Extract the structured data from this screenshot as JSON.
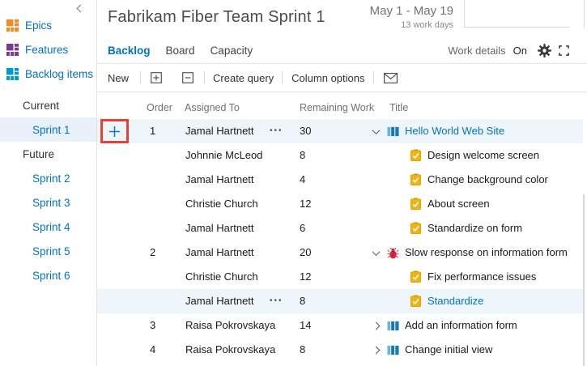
{
  "colors": {
    "accent": "#0072c6",
    "row_highlight": "#eef6fc",
    "annotation_red": "#e84033",
    "epics_icon": "#f58b1f",
    "features_icon": "#773b93",
    "backlog_items_icon": "#009ccc",
    "task_icon_yellow": "#f0b30f",
    "bug_icon_red": "#cc293d",
    "pbi_icon_blue": "#1279c0"
  },
  "icons": {
    "collapse_sidebar": "chevron-left",
    "backlog_level": "treemap-squares",
    "expand_item": "boxed-plus",
    "collapse_item": "boxed-minus",
    "email": "envelope",
    "settings": "gear",
    "fullscreen": "corner-brackets",
    "add_task": "plus",
    "context_menu": "ellipsis-dots"
  },
  "sidebar": {
    "levels": [
      {
        "label": "Epics",
        "color": "#f58b1f"
      },
      {
        "label": "Features",
        "color": "#773b93"
      },
      {
        "label": "Backlog items",
        "color": "#009ccc"
      }
    ],
    "groups": [
      {
        "label": "Current",
        "items": [
          {
            "label": "Sprint 1",
            "selected": true
          }
        ]
      },
      {
        "label": "Future",
        "items": [
          {
            "label": "Sprint 2"
          },
          {
            "label": "Sprint 3"
          },
          {
            "label": "Sprint 4"
          },
          {
            "label": "Sprint 5"
          },
          {
            "label": "Sprint 6"
          }
        ]
      }
    ]
  },
  "header": {
    "title": "Fabrikam Fiber Team Sprint 1",
    "date_range": "May 1 - May 19",
    "work_days": "13 work days",
    "tabs": [
      {
        "label": "Backlog",
        "active": true
      },
      {
        "label": "Board",
        "active": false
      },
      {
        "label": "Capacity",
        "active": false
      }
    ],
    "work_details_label": "Work details",
    "work_details_state": "On"
  },
  "toolbar": {
    "new_label": "New",
    "create_query_label": "Create query",
    "column_options_label": "Column options"
  },
  "table": {
    "columns": [
      "Order",
      "Assigned To",
      "Remaining Work",
      "Title"
    ],
    "context_menu_glyph": "•••",
    "rows": [
      {
        "order": "1",
        "assigned": "Jamal Hartnett",
        "menu": true,
        "remaining": "30",
        "title": "Hello World Web Site",
        "type": "pbi",
        "expand": "down",
        "level": 0,
        "selected": true,
        "link": true,
        "annotated": true
      },
      {
        "order": "",
        "assigned": "Johnnie McLeod",
        "menu": false,
        "remaining": "8",
        "title": "Design welcome screen",
        "type": "task",
        "expand": "",
        "level": 1,
        "selected": false,
        "link": false,
        "annotated": false
      },
      {
        "order": "",
        "assigned": "Jamal Hartnett",
        "menu": false,
        "remaining": "4",
        "title": "Change background color",
        "type": "task",
        "expand": "",
        "level": 1,
        "selected": false,
        "link": false,
        "annotated": false
      },
      {
        "order": "",
        "assigned": "Christie Church",
        "menu": false,
        "remaining": "12",
        "title": "About screen",
        "type": "task",
        "expand": "",
        "level": 1,
        "selected": false,
        "link": false,
        "annotated": false
      },
      {
        "order": "",
        "assigned": "Jamal Hartnett",
        "menu": false,
        "remaining": "6",
        "title": "Standardize on form",
        "type": "task",
        "expand": "",
        "level": 1,
        "selected": false,
        "link": false,
        "annotated": false
      },
      {
        "order": "2",
        "assigned": "Jamal Hartnett",
        "menu": false,
        "remaining": "20",
        "title": "Slow response on information form",
        "type": "bug",
        "expand": "down",
        "level": 0,
        "selected": false,
        "link": false,
        "annotated": false
      },
      {
        "order": "",
        "assigned": "Christie Church",
        "menu": false,
        "remaining": "12",
        "title": "Fix performance issues",
        "type": "task",
        "expand": "",
        "level": 1,
        "selected": false,
        "link": false,
        "annotated": false
      },
      {
        "order": "",
        "assigned": "Jamal Hartnett",
        "menu": true,
        "remaining": "8",
        "title": "Standardize",
        "type": "task",
        "expand": "",
        "level": 1,
        "selected": true,
        "link": true,
        "annotated": false
      },
      {
        "order": "3",
        "assigned": "Raisa Pokrovskaya",
        "menu": false,
        "remaining": "14",
        "title": "Add an information form",
        "type": "pbi",
        "expand": "right",
        "level": 0,
        "selected": false,
        "link": false,
        "annotated": false
      },
      {
        "order": "4",
        "assigned": "Raisa Pokrovskaya",
        "menu": false,
        "remaining": "8",
        "title": "Change initial view",
        "type": "pbi",
        "expand": "right",
        "level": 0,
        "selected": false,
        "link": false,
        "annotated": false
      }
    ]
  }
}
